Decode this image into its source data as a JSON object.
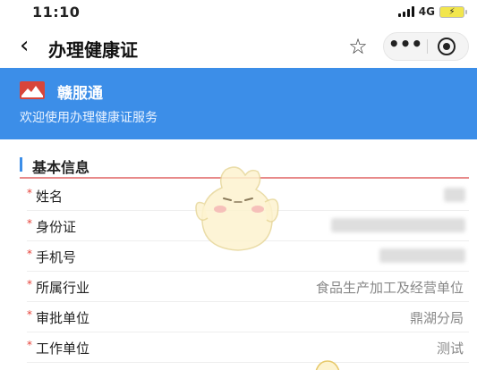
{
  "status_bar": {
    "time": "11:10",
    "network": "4G",
    "battery_symbol": "⚡"
  },
  "nav": {
    "back_icon": "‹",
    "title": "办理健康证",
    "star_icon": "☆",
    "more_icon": "•••"
  },
  "banner": {
    "brand": "赣服通",
    "subtitle": "欢迎使用办理健康证服务",
    "background": "#3c8ee8"
  },
  "section": {
    "title": "基本信息"
  },
  "form": {
    "required_mark": "*",
    "fields": [
      {
        "label": "姓名",
        "value": ""
      },
      {
        "label": "身份证",
        "value": ""
      },
      {
        "label": "手机号",
        "value": ""
      },
      {
        "label": "所属行业",
        "value": "食品生产加工及经营单位"
      },
      {
        "label": "审批单位",
        "value": "鼎湖分局"
      },
      {
        "label": "工作单位",
        "value": "测试"
      }
    ]
  },
  "colors": {
    "accent": "#3c8ee8",
    "required": "#e5433a",
    "section_underline": "#e88a8a"
  }
}
